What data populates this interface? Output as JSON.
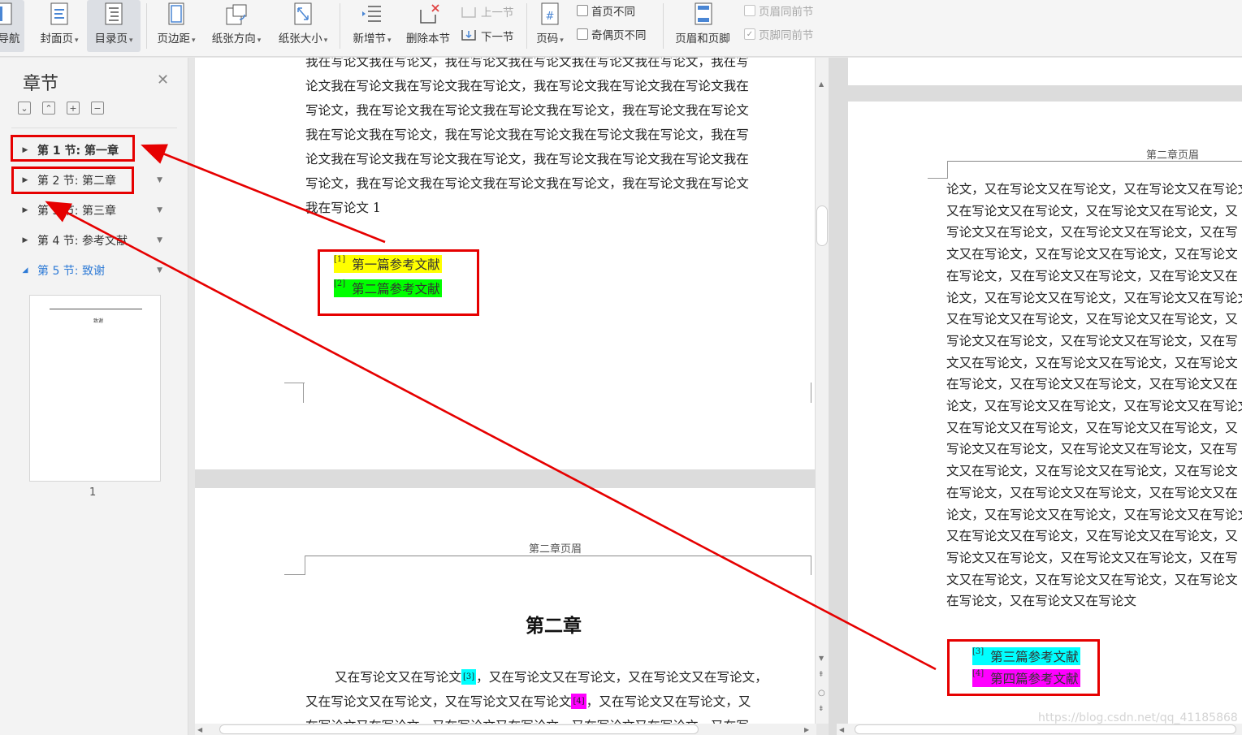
{
  "toolbar": {
    "nav_label": "导航",
    "cover_page_label": "封面页",
    "toc_page_label": "目录页",
    "margin_label": "页边距",
    "orientation_label": "纸张方向",
    "paper_size_label": "纸张大小",
    "new_section_label": "新增节",
    "delete_section_label": "删除本节",
    "prev_section_label": "上一节",
    "next_section_label": "下一节",
    "page_number_label": "页码",
    "first_page_diff_label": "首页不同",
    "odd_even_diff_label": "奇偶页不同",
    "header_footer_label": "页眉和页脚",
    "header_same_prev_label": "页眉同前节",
    "footer_same_prev_label": "页脚同前节",
    "footer_same_prev_checked": true
  },
  "sidebar": {
    "title": "章节",
    "items": [
      {
        "label": "第 1 节: 第一章"
      },
      {
        "label": "第 2 节: 第二章"
      },
      {
        "label": "第 3 节: 第三章"
      },
      {
        "label": "第 4 节: 参考文献"
      },
      {
        "label": "第 5 节: 致谢"
      }
    ],
    "thumbnail_title": "致谢",
    "thumbnail_page_number": "1"
  },
  "left_doc": {
    "page1_lines": [
      "我在写论文我在写论文，我在写论文我在写论文我在写论文我在写论文，我在写",
      "论文我在写论文我在写论文我在写论文，我在写论文我在写论文我在写论文我在",
      "写论文，我在写论文我在写论文我在写论文我在写论文，我在写论文我在写论文",
      "我在写论文我在写论文，我在写论文我在写论文我在写论文我在写论文，我在写",
      "论文我在写论文我在写论文我在写论文，我在写论文我在写论文我在写论文我在",
      "写论文，我在写论文我在写论文我在写论文我在写论文，我在写论文我在写论文",
      "我在写论文 1"
    ],
    "footnotes": [
      {
        "num": "[1]",
        "text": "第一篇参考文献"
      },
      {
        "num": "[2]",
        "text": "第二篇参考文献"
      }
    ],
    "page2_header": "第二章页眉",
    "chapter_title": "第二章",
    "page2_line1_a": "又在写论文又在写论文",
    "page2_ref3": "[3]",
    "page2_line1_b": "，又在写论文又在写论文，又在写论文又在写论文，",
    "page2_line2_a": "又在写论文又在写论文，又在写论文又在写论文",
    "page2_ref4": "[4]",
    "page2_line2_b": "，又在写论文又在写论文，又",
    "page2_line3": "在写论文又在写论文，又在写论文又在写论文，又在写论文又在写论文，又在写"
  },
  "right_doc": {
    "header": "第二章页眉",
    "lines": [
      "论文，又在写论文又在写论文，又在写论文又在写论文",
      "又在写论文又在写论文，又在写论文又在写论文，又",
      "写论文又在写论文，又在写论文又在写论文，又在写",
      "文又在写论文，又在写论文又在写论文，又在写论文",
      "在写论文，又在写论文又在写论文，又在写论文又在",
      "论文，又在写论文又在写论文，又在写论文又在写论文",
      "又在写论文又在写论文，又在写论文又在写论文，又",
      "写论文又在写论文，又在写论文又在写论文，又在写",
      "文又在写论文，又在写论文又在写论文，又在写论文",
      "在写论文，又在写论文又在写论文，又在写论文又在",
      "论文，又在写论文又在写论文，又在写论文又在写论文",
      "又在写论文又在写论文，又在写论文又在写论文，又",
      "写论文又在写论文，又在写论文又在写论文，又在写",
      "文又在写论文，又在写论文又在写论文，又在写论文",
      "在写论文，又在写论文又在写论文，又在写论文又在",
      "论文，又在写论文又在写论文，又在写论文又在写论文",
      "又在写论文又在写论文，又在写论文又在写论文，又",
      "写论文又在写论文，又在写论文又在写论文，又在写",
      "文又在写论文，又在写论文又在写论文，又在写论文",
      "在写论文，又在写论文又在写论文"
    ],
    "footnotes": [
      {
        "num": "[3]",
        "text": "第三篇参考文献"
      },
      {
        "num": "[4]",
        "text": "第四篇参考文献"
      }
    ]
  },
  "watermark": "https://blog.csdn.net/qq_41185868",
  "colors": {
    "annotation_red": "#e60000",
    "highlight_yellow": "#ffff00",
    "highlight_green": "#00ff00",
    "highlight_cyan": "#00ffff",
    "highlight_magenta": "#ff00ff",
    "selected_blue": "#2d7ad6"
  }
}
